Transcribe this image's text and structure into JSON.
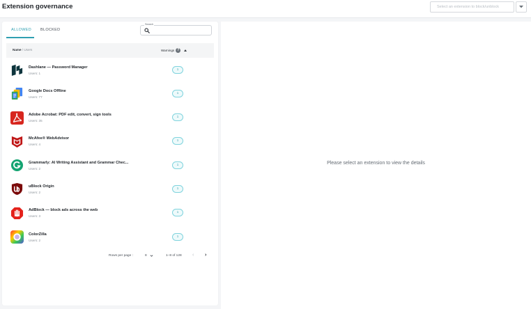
{
  "header": {
    "title": "Extension governance",
    "select_placeholder": "Select an extension to block/unblock"
  },
  "tabs": [
    {
      "label": "ALLOWED",
      "active": true
    },
    {
      "label": "BLOCKED",
      "active": false
    }
  ],
  "search": {
    "label": "Search",
    "value": ""
  },
  "table": {
    "col_name": "Name",
    "col_name_sub": "/ Users",
    "col_warnings": "Warnings",
    "sort": "ascending",
    "rows": [
      {
        "name": "Dashlane — Password Manager",
        "users": "Users: 1",
        "warnings": "1",
        "icon": "dashlane-logo-icon"
      },
      {
        "name": "Google Docs Offline",
        "users": "Users: 77",
        "warnings": "1",
        "icon": "google-docs-logo-icon"
      },
      {
        "name": "Adobe Acrobat: PDF edit, convert, sign tools",
        "users": "Users: 35",
        "warnings": "1",
        "icon": "adobe-acrobat-logo-icon"
      },
      {
        "name": "McAfee® WebAdvisor",
        "users": "Users: 4",
        "warnings": "1",
        "icon": "mcafee-logo-icon"
      },
      {
        "name": "Grammarly: AI Writing Assistant and Grammar Chec...",
        "users": "Users: 2",
        "warnings": "1",
        "icon": "grammarly-logo-icon"
      },
      {
        "name": "uBlock Origin",
        "users": "Users: 2",
        "warnings": "1",
        "icon": "ublock-logo-icon"
      },
      {
        "name": "AdBlock — block ads across the web",
        "users": "Users: 3",
        "warnings": "1",
        "icon": "adblock-logo-icon"
      },
      {
        "name": "ColorZilla",
        "users": "Users: 2",
        "warnings": "1",
        "icon": "colorzilla-logo-icon"
      }
    ]
  },
  "pagination": {
    "rows_per_page_label": "Rows per page :",
    "rows_per_page": "8",
    "range": "1–8 of 128"
  },
  "details": {
    "empty_message": "Please select an extension to view the details"
  },
  "colors": {
    "accent": "#2f9fb1",
    "badge_border": "#7fd3dd"
  }
}
